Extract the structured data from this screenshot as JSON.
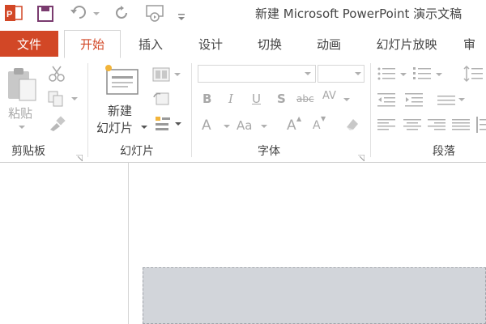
{
  "window": {
    "title": "新建 Microsoft PowerPoint 演示文稿",
    "app_icon": "powerpoint-icon",
    "qat": [
      "save-icon",
      "undo-icon",
      "redo-icon",
      "present-icon",
      "customize-icon"
    ]
  },
  "tabs": {
    "file": "文件",
    "items": [
      "开始",
      "插入",
      "设计",
      "切换",
      "动画",
      "幻灯片放映",
      "审"
    ],
    "active": "开始"
  },
  "ribbon": {
    "clipboard": {
      "label": "剪贴板",
      "paste": "粘贴"
    },
    "slides": {
      "label": "幻灯片",
      "new_slide_line1": "新建",
      "new_slide_line2": "幻灯片"
    },
    "font": {
      "label": "字体",
      "bold": "B",
      "italic": "I",
      "underline": "U",
      "shadow": "S",
      "strike": "abc",
      "spacing": "AV",
      "grow_a": "A",
      "case_aa": "Aa",
      "grow": "A",
      "shrink": "A"
    },
    "paragraph": {
      "label": "段落"
    }
  },
  "colors": {
    "accent": "#d24726",
    "slide_bg": "#d2d5da"
  }
}
